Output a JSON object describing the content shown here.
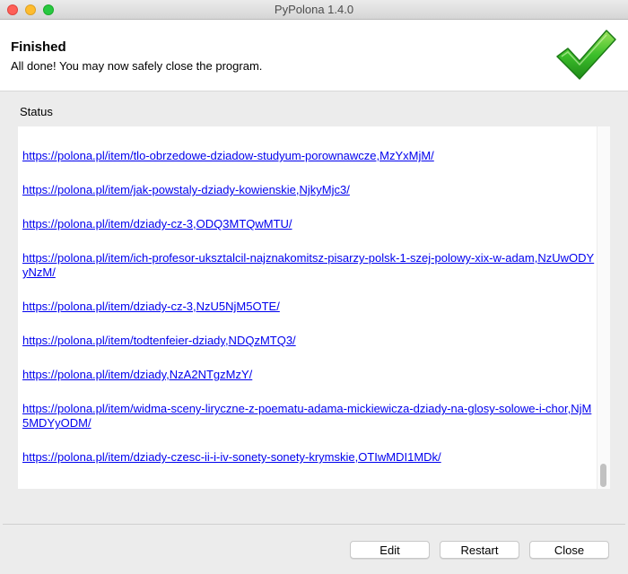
{
  "window": {
    "title": "PyPolona 1.4.0"
  },
  "header": {
    "title": "Finished",
    "subtitle": "All done! You may now safely close the program.",
    "icon": "green-checkmark-icon",
    "icon_color": "#2fb52f"
  },
  "status": {
    "label": "Status",
    "links": [
      "https://polona.pl/item/tlo-obrzedowe-dziadow-studyum-porownawcze,MzYxMjM/",
      "https://polona.pl/item/jak-powstaly-dziady-kowienskie,NjkyMjc3/",
      "https://polona.pl/item/dziady-cz-3,ODQ3MTQwMTU/",
      "https://polona.pl/item/ich-profesor-uksztalcil-najznakomitsz-pisarzy-polsk-1-szej-polowy-xix-w-adam,NzUwODYyNzM/",
      "https://polona.pl/item/dziady-cz-3,NzU5NjM5OTE/",
      "https://polona.pl/item/todtenfeier-dziady,NDQzMTQ3/",
      "https://polona.pl/item/dziady,NzA2NTgzMzY/",
      "https://polona.pl/item/widma-sceny-liryczne-z-poematu-adama-mickiewicza-dziady-na-glosy-solowe-i-chor,NjM5MDYyODM/",
      "https://polona.pl/item/dziady-czesc-ii-i-iv-sonety-sonety-krymskie,OTIwMDI1MDk/"
    ],
    "link_color": "#0000ee"
  },
  "buttons": {
    "edit": "Edit",
    "restart": "Restart",
    "close": "Close"
  }
}
